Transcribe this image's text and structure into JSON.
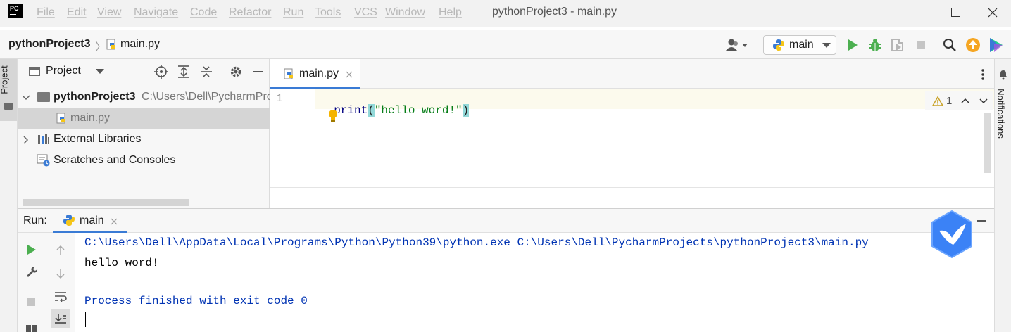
{
  "app": {
    "logo_text": "PC"
  },
  "window": {
    "title": "pythonProject3 - main.py"
  },
  "menu": [
    "File",
    "Edit",
    "View",
    "Navigate",
    "Code",
    "Refactor",
    "Run",
    "Tools",
    "VCS",
    "Window",
    "Help"
  ],
  "breadcrumb": {
    "project": "pythonProject3",
    "file": "main.py"
  },
  "run_config": {
    "selected": "main"
  },
  "left_stripe": {
    "project_label": "Project"
  },
  "right_stripe": {
    "notifications_label": "Notifications"
  },
  "project_panel": {
    "title": "Project",
    "tree": {
      "root_name": "pythonProject3",
      "root_path": "C:\\Users\\Dell\\PycharmPro",
      "file": "main.py",
      "external_libraries": "External Libraries",
      "scratches": "Scratches and Consoles"
    }
  },
  "editor": {
    "tab_label": "main.py",
    "line_number": "1",
    "code": {
      "func": "print",
      "open_paren": "(",
      "string": "\"hello word!\"",
      "close_paren": ")"
    },
    "inspection": {
      "warnings": "1"
    }
  },
  "run_panel": {
    "label": "Run:",
    "tab_label": "main",
    "console": {
      "command": "C:\\Users\\Dell\\AppData\\Local\\Programs\\Python\\Python39\\python.exe C:\\Users\\Dell\\PycharmProjects\\pythonProject3\\main.py",
      "output": "hello word!",
      "exit": "Process finished with exit code 0"
    }
  },
  "colors": {
    "keyword": "#000080",
    "string": "#067d17",
    "paren_highlight": "#93d9d9",
    "console_system": "#0033b3",
    "run_green": "#4caf50",
    "accent_blue": "#3a7bd5",
    "update_orange": "#f5a623"
  }
}
